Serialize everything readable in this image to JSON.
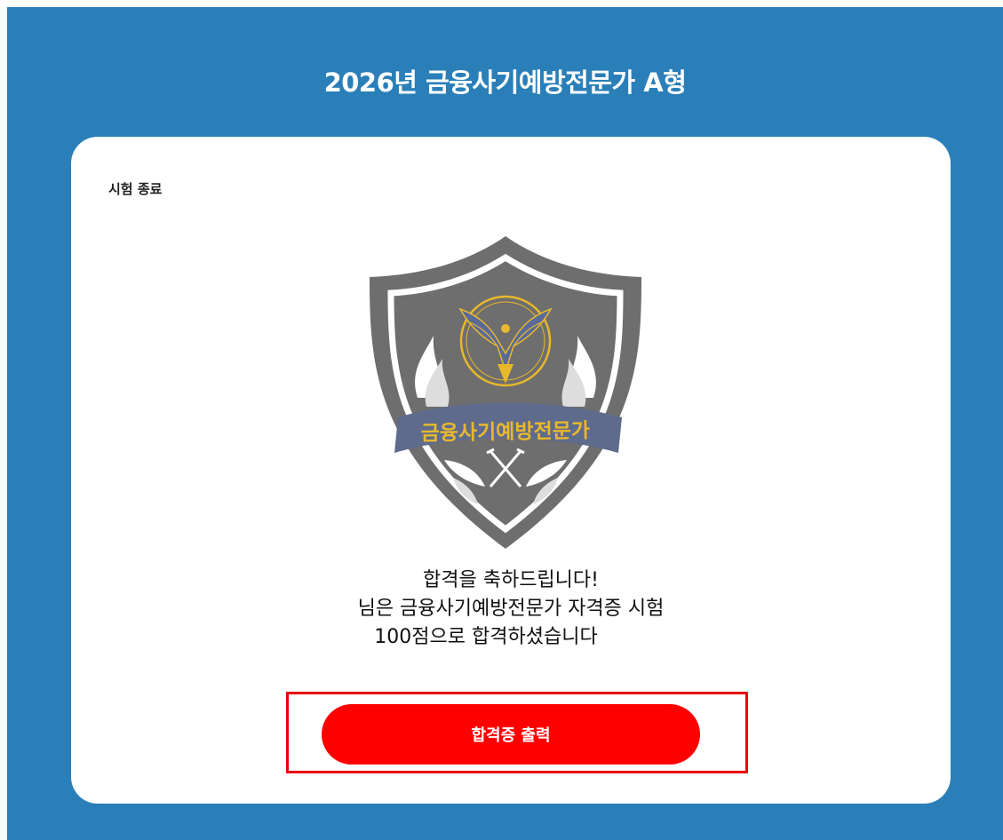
{
  "header": {
    "title": "2026년 금융사기예방전문가 A형"
  },
  "card": {
    "status_label": "시험 종료",
    "emblem": {
      "banner_text": "금융사기예방전문가",
      "colors": {
        "shield": "#6e6e6e",
        "gold": "#e8b82c",
        "banner": "#5e6b8c",
        "white": "#ffffff"
      }
    },
    "message": {
      "line1": "합격을 축하드립니다!",
      "line2": "님은 금융사기예방전문가 자격증 시험",
      "line3": "100점으로 합격하셨습니다"
    },
    "print_button_label": "합격증 출력"
  },
  "colors": {
    "background": "#2a7fb8",
    "accent": "#ff0000",
    "highlight_border": "#e8000b"
  }
}
